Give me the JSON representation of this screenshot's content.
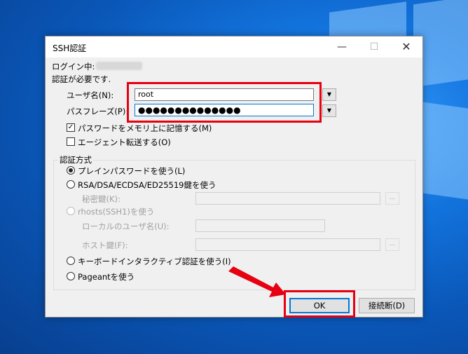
{
  "dialog": {
    "title": "SSH認証",
    "logging_in_label": "ログイン中:",
    "auth_required_text": "認証が必要です.",
    "username": {
      "label": "ユーザ名(N):",
      "value": "root"
    },
    "passphrase": {
      "label": "パスフレーズ(P):",
      "value": "●●●●●●●●●●●●●●"
    },
    "remember_password": {
      "label": "パスワードをメモリ上に記憶する(M)",
      "checked": true,
      "mark": "✓"
    },
    "agent_forwarding": {
      "label": "エージェント転送する(O)",
      "checked": false
    },
    "auth_method_group": "認証方式",
    "methods": {
      "plain_password": "プレインパスワードを使う(L)",
      "rsa_key": "RSA/DSA/ECDSA/ED25519鍵を使う",
      "private_key_label": "秘密鍵(K):",
      "rhosts": "rhosts(SSH1)を使う",
      "local_user_label": "ローカルのユーザ名(U):",
      "host_key_label": "ホスト鍵(F):",
      "keyboard_interactive": "キーボードインタラクティブ認証を使う(I)",
      "pageant": "Pageantを使う"
    },
    "browse_label": "...",
    "ok_label": "OK",
    "disconnect_label": "接続断(D)",
    "window_controls": {
      "minimize": "—",
      "maximize": "☐",
      "close": "✕"
    },
    "dropdown_glyph": "▼"
  },
  "annotation": {
    "color": "#e60012"
  }
}
